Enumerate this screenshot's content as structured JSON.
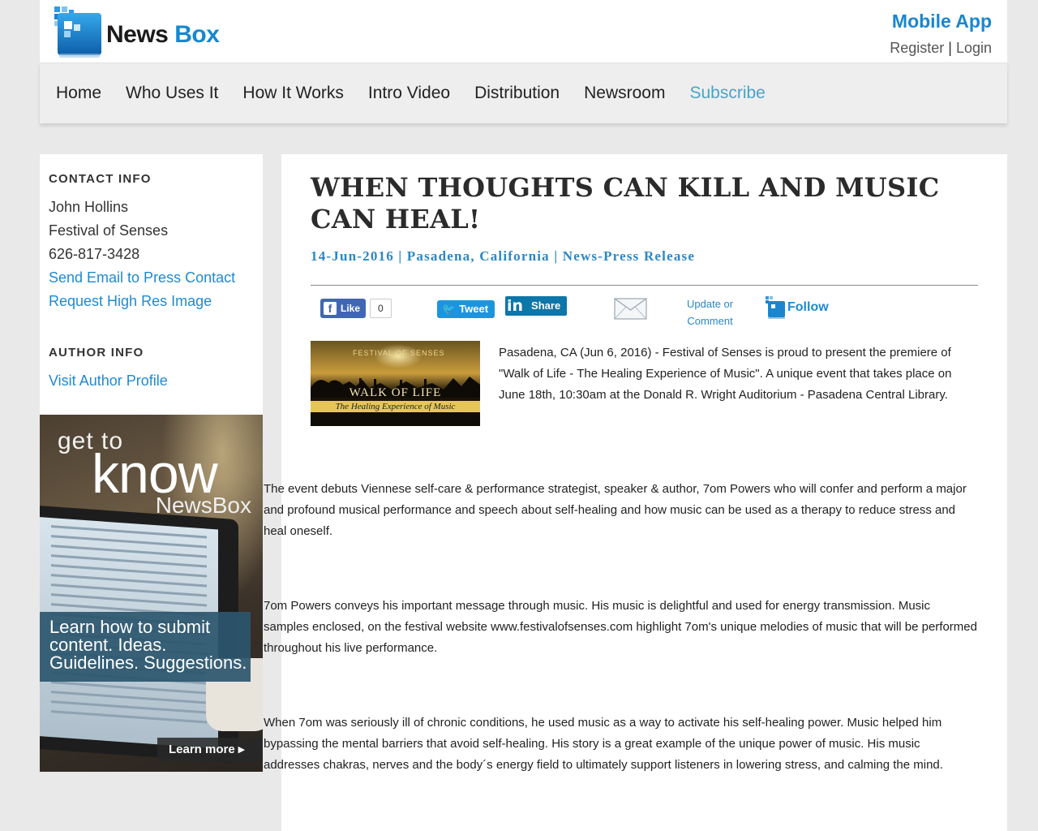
{
  "header": {
    "logo": {
      "word1": "News",
      "word2": "Box"
    },
    "mobile_app": "Mobile App",
    "register": "Register",
    "separator": "|",
    "login": "Login"
  },
  "nav": {
    "items": [
      {
        "label": "Home"
      },
      {
        "label": "Who Uses It"
      },
      {
        "label": "How It Works"
      },
      {
        "label": "Intro Video"
      },
      {
        "label": "Distribution"
      },
      {
        "label": "Newsroom"
      },
      {
        "label": "Subscribe",
        "active": true
      }
    ]
  },
  "sidebar": {
    "contact_heading": "CONTACT INFO",
    "contact_name": "John Hollins",
    "contact_org": "Festival of Senses",
    "contact_phone": "626-817-3428",
    "send_email": "Send Email to Press Contact",
    "request_image": "Request High Res Image",
    "author_heading": "AUTHOR INFO",
    "author_profile": "Visit Author Profile"
  },
  "ad": {
    "get_to": "get to",
    "know": "know",
    "newsbox": "NewsBox",
    "box_line1": "Learn how to submit",
    "box_line2": "content. Ideas.",
    "box_line3": "Guidelines. Suggestions.",
    "learn_more": "Learn more ▸"
  },
  "article": {
    "title": "WHEN THOUGHTS CAN KILL AND MUSIC CAN HEAL!",
    "date": "14-Jun-2016",
    "location": "Pasadena, California",
    "category": "News-Press Release",
    "dateline_sep": "|",
    "share": {
      "like_label": "Like",
      "like_count": "0",
      "tweet_label": "Tweet",
      "linkedin_label": "Share",
      "update_line1": "Update or",
      "update_line2": "Comment",
      "follow_label": "Follow"
    },
    "hero_image": {
      "brand": "FESTIVAL OF SENSES",
      "title": "WALK OF LIFE",
      "subtitle": "The Healing Experience of Music"
    },
    "intro": "Pasadena, CA (Jun 6, 2016) - Festival of Senses is proud to present the premiere of \"Walk of Life - The Healing Experience of Music\". A unique event that takes place on June 18th, 10:30am at the Donald R. Wright Auditorium - Pasadena Central Library.",
    "paragraphs": [
      "The event debuts Viennese self-care & performance strategist, speaker & author, 7om Powers who will confer and perform a major and profound musical performance and speech about self-healing and how music can be used as a therapy to reduce stress and heal oneself.",
      "7om Powers conveys his important message through music. His music is delightful and used for energy transmission. Music samples enclosed, on the festival website www.festivalofsenses.com highlight 7om's unique melodies of music that will be performed throughout his live performance.",
      "When 7om was seriously ill of chronic conditions, he used music as a way to activate his self-healing power. Music helped him bypassing the mental barriers that avoid self-healing. His story is a great example of the unique power of music. His music addresses chakras, nerves and the body´s energy field to ultimately support listeners in lowering stress, and calming the mind."
    ]
  },
  "colors": {
    "brand_blue": "#1a86cf",
    "link_blue": "#1f8ad0",
    "nav_active": "#4aa3c8",
    "facebook": "#4267b2",
    "twitter": "#1b95e0",
    "linkedin": "#0e76a8"
  }
}
